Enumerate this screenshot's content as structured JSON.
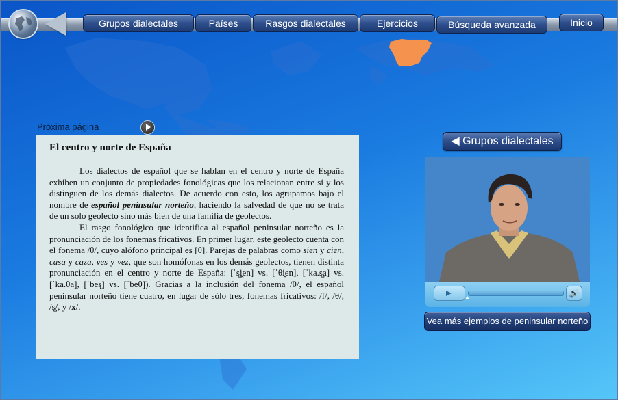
{
  "nav": {
    "items": [
      {
        "label": "Grupos dialectales"
      },
      {
        "label": "Países"
      },
      {
        "label": "Rasgos dialectales"
      },
      {
        "label": "Ejercicios"
      },
      {
        "label": "Búsqueda avanzada"
      },
      {
        "label": "Inicio"
      }
    ]
  },
  "next_page_label": "Próxima página",
  "article": {
    "title": "El centro y norte de España",
    "p1_a": "Los dialectos de español que se hablan en el centro y norte de España exhiben un conjunto de propiedades fonológicas que los relacionan entre sí y los distinguen de los demás dialectos. De acuerdo con esto, los agrupamos bajo el nombre de ",
    "p1_em": "español peninsular norteño",
    "p1_b": ", haciendo la salvedad de que no se trata de un solo geolecto sino más bien de una familia de geolectos.",
    "p2_a": "El rasgo fonológico que identifica al español peninsular norteño es la pronunciación de los fonemas fricativos.  En primer lugar, este geolecto cuenta con el fonema /θ/, cuyo alófono principal es [θ]. Parejas de palabras como ",
    "w1": "sien",
    "y1": " y ",
    "w2": "cien",
    "c1": ", ",
    "w3": "casa",
    "y2": " y ",
    "w4": "caza",
    "c2": ", ",
    "w5": "ves",
    "y3": " y ",
    "w6": "vez",
    "p2_b": ", que son homófonas en los demás geolectos, tienen distinta pronunciación en el centro y norte de España: [ˈs̺i̯en] vs. [ˈθi̯en], [ˈka.s̺a] vs. [ˈka.θa], [ˈbes̺] vs. [ˈbeθ]). Gracias a la inclusión del fonema /θ/, el español peninsular norteño tiene cuatro, en lugar de sólo tres, fonemas fricativos: /f/, /θ/, /s̺/, y /",
    "p2_x": "x",
    "p2_c": "/."
  },
  "video": {
    "back_button_label": "◀ Grupos dialectales",
    "progress": 0.0,
    "more_examples_label": "Vea más ejemplos de peninsular norteño"
  },
  "colors": {
    "background_top": "#0a55c8",
    "background_bottom": "#55c6f8",
    "highlight_region": "#f5924e",
    "article_bg": "#dde8e8",
    "button": "#2e4f8c"
  },
  "icons": [
    "globe-icon",
    "back-arrow-icon",
    "next-page-icon",
    "play-icon",
    "volume-icon"
  ]
}
